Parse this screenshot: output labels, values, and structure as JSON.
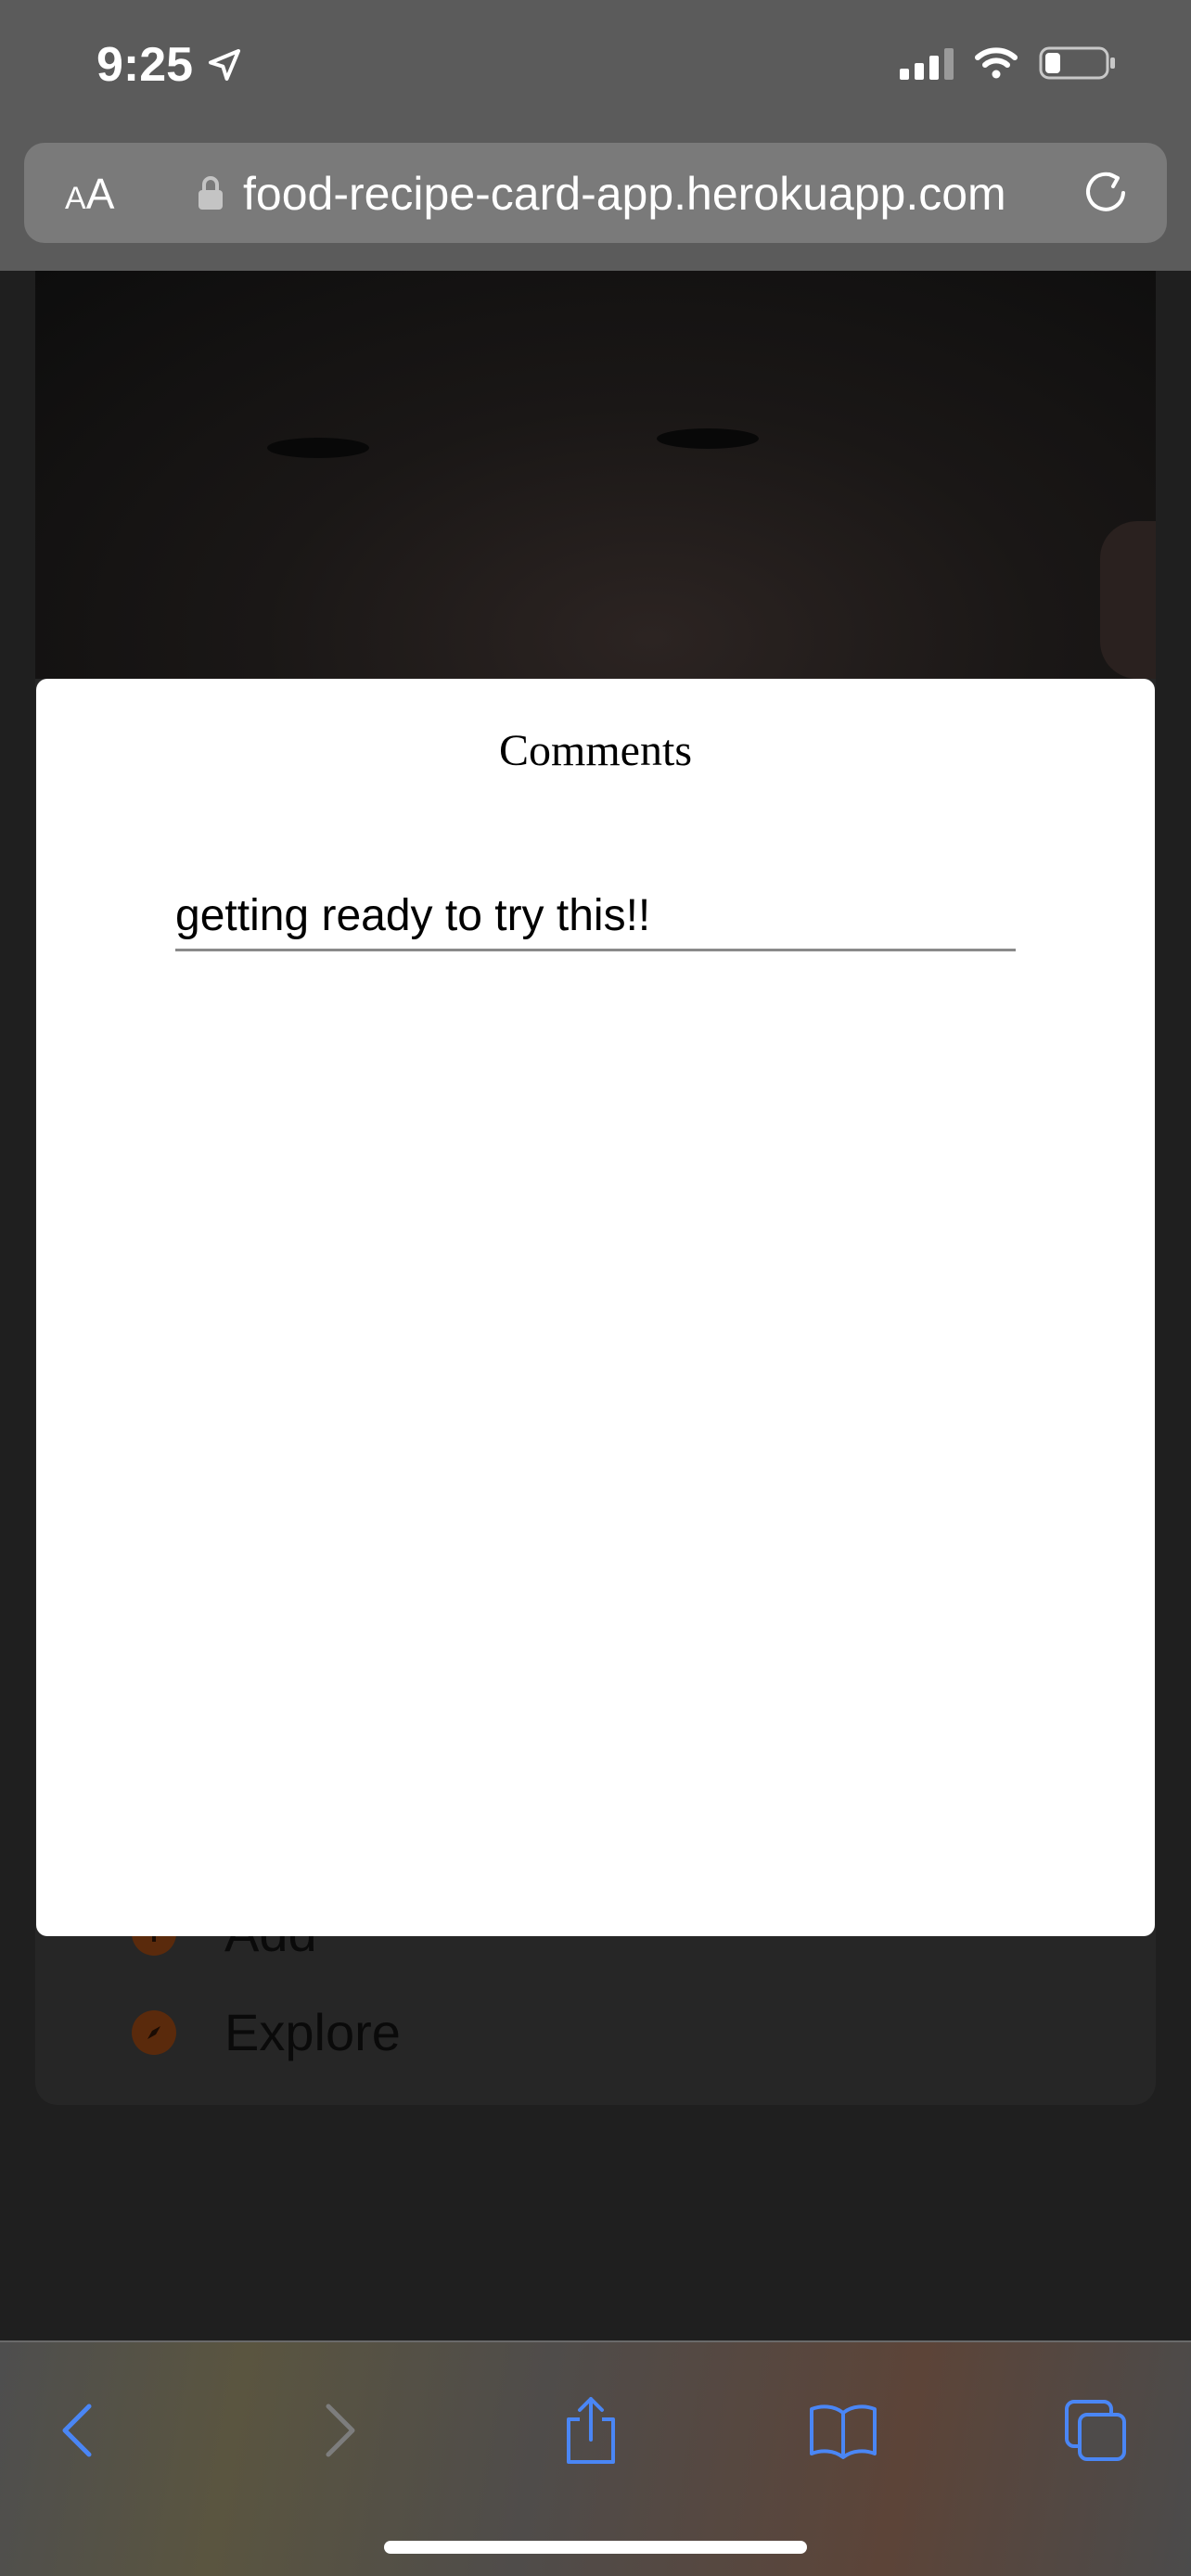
{
  "status_bar": {
    "time": "9:25",
    "location_icon": "location-arrow-icon",
    "signal_icon": "cellular-signal-icon",
    "wifi_icon": "wifi-icon",
    "battery_icon": "battery-icon"
  },
  "browser": {
    "text_size_label_small": "A",
    "text_size_label_big": "A",
    "lock_icon": "lock-icon",
    "url": "food-recipe-card-app.herokuapp.com",
    "reload_icon": "reload-icon"
  },
  "background_menu": {
    "items": [
      {
        "label": "Add",
        "icon": "add-circle-icon"
      },
      {
        "label": "Explore",
        "icon": "compass-icon"
      }
    ]
  },
  "modal": {
    "title": "Comments",
    "comment_value": "getting ready to try this!!"
  },
  "toolbar": {
    "back_icon": "chevron-left-icon",
    "forward_icon": "chevron-right-icon",
    "share_icon": "share-icon",
    "bookmarks_icon": "book-icon",
    "tabs_icon": "tabs-icon"
  },
  "colors": {
    "accent": "#4a86f5",
    "modal_background": "#ffffff",
    "overlay_dim": "#1f1f1f"
  }
}
